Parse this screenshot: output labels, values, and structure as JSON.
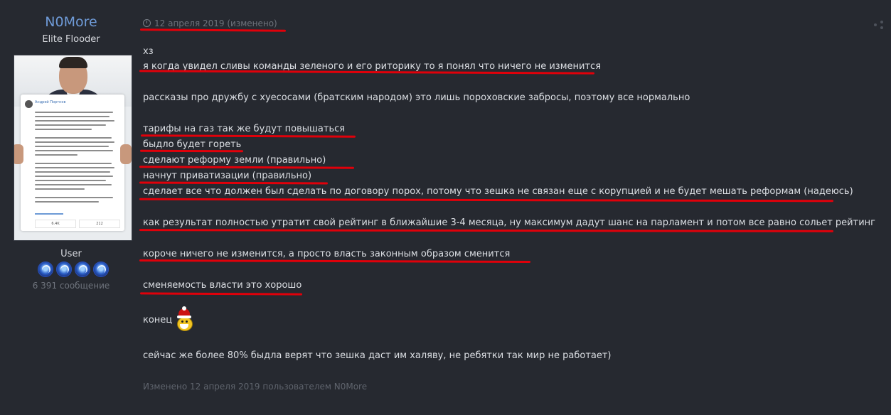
{
  "author": {
    "name": "N0More",
    "title": "Elite Flooder",
    "group": "User",
    "post_count": "6 391 сообщение",
    "avatar_card": {
      "name": "Андрей Портнов",
      "likes": "6.4K",
      "dislikes": "212"
    }
  },
  "post": {
    "date": "12 апреля 2019 (изменено)",
    "lines": [
      "хз",
      "я когда увидел сливы команды зеленого и его риторику то я понял что ничего не изменится",
      "рассказы про дружбу с хуесосами (братским народом) это лишь пороховские забросы, поэтому все нормально",
      "тарифы на газ так же будут повышаться",
      "быдло будет гореть",
      "сделают реформу земли (правильно)",
      "начнут приватизации (правильно)",
      "сделает все что должен был сделать по договору порох, потому что зешка не связан еще с корупцией и не будет мешать реформам (надеюсь)",
      "как результат полностью утратит свой рейтинг в ближайшие 3-4 месяца, ну максимум дадут шанс на парламент и потом все равно сольет рейтинг",
      "короче ничего не изменится, а просто власть законным образом сменится",
      "сменяемость власти это хорошо",
      "конец",
      "сейчас же более 80% быдла верят что зешка даст им халяву, не ребятки так мир не работает)"
    ],
    "edited_note": "Изменено 12 апреля 2019 пользователем N0More"
  },
  "colors": {
    "background": "#262930",
    "author_name": "#6f9bd8",
    "annotation_red": "#e0000a"
  },
  "icons": [
    "clock-icon",
    "share-icon",
    "rank-badge-icon",
    "santa-emoji-icon"
  ]
}
